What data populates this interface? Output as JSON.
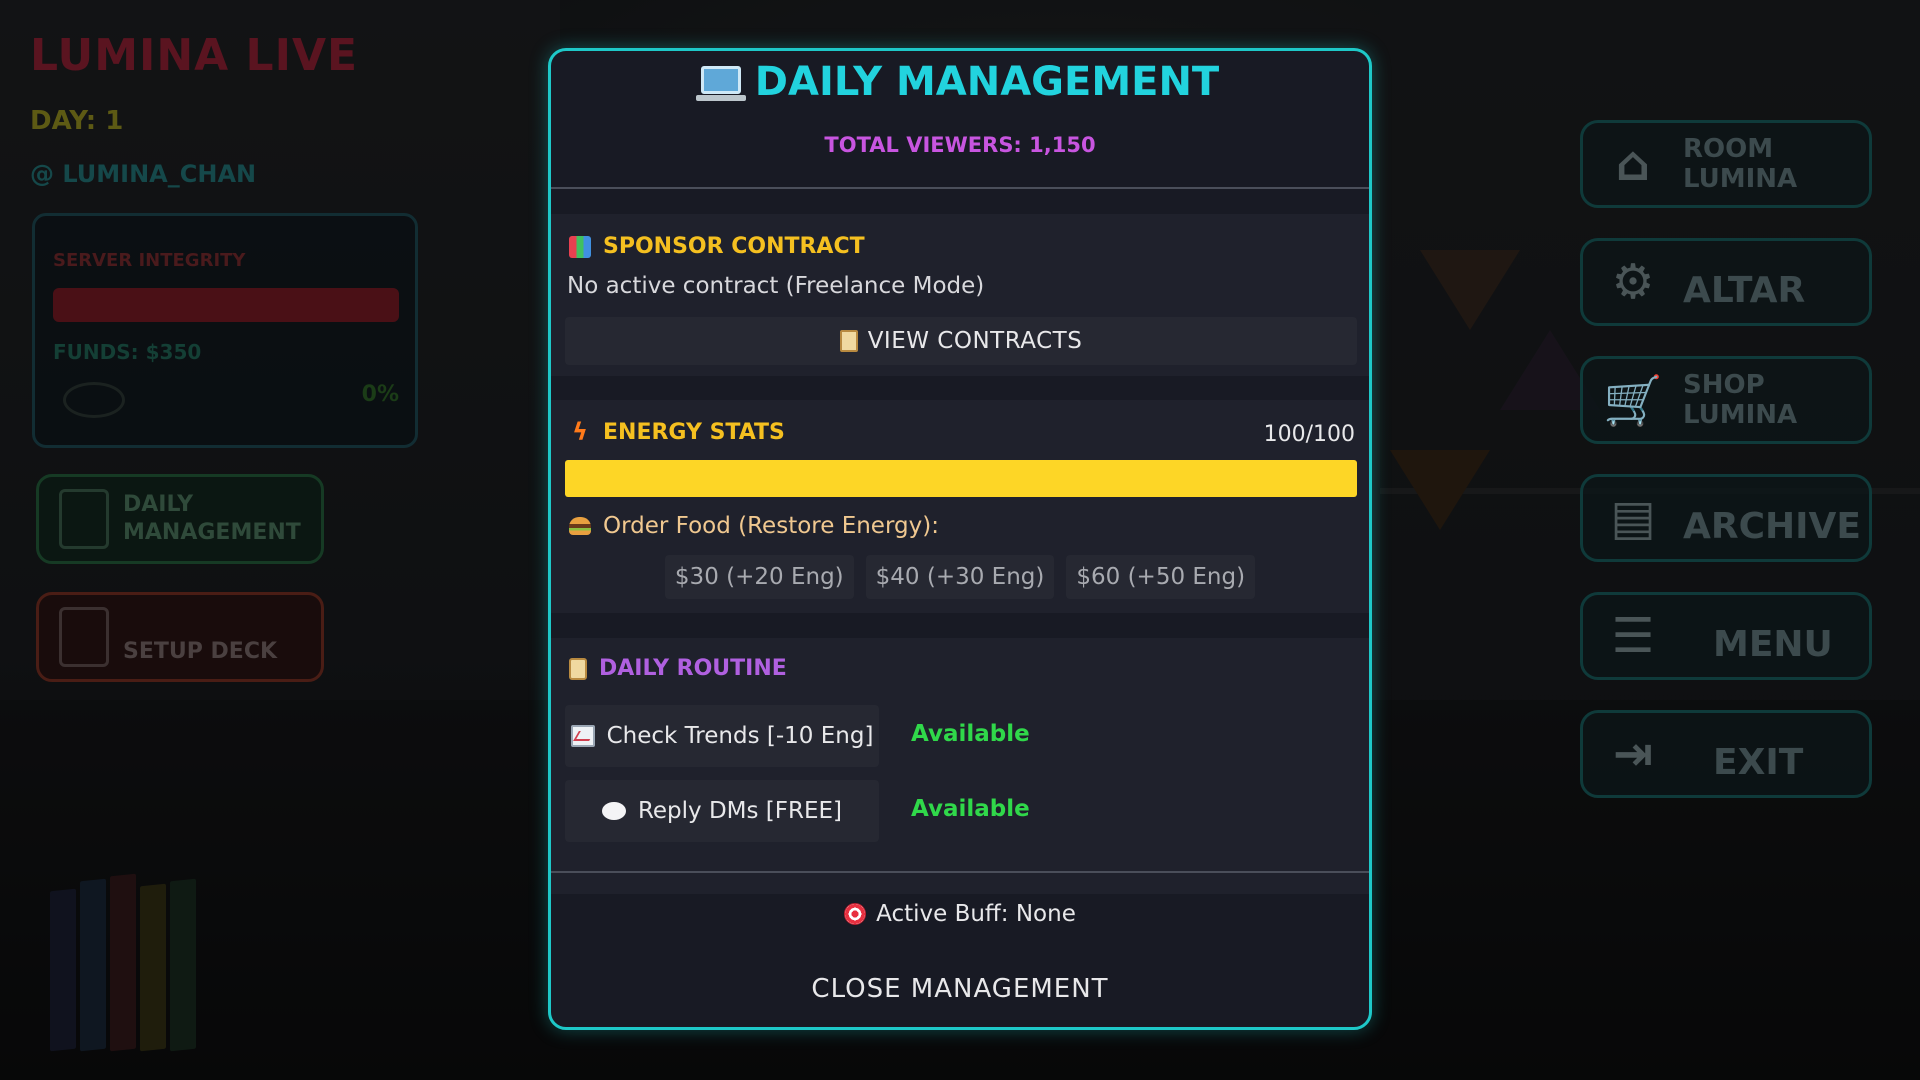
{
  "hud": {
    "title": "LUMINA LIVE",
    "day": "DAY: 1",
    "handle": "@ LUMINA_CHAN",
    "server_label": "SERVER INTEGRITY",
    "funds": "FUNDS: $350",
    "percent": "0%",
    "daily_btn": "DAILY MANAGEMENT",
    "deck_btn": "SETUP DECK"
  },
  "right_menu": [
    {
      "label": "ROOM LUMINA",
      "icon": "house-icon"
    },
    {
      "label": "ALTAR",
      "icon": "gear-icon"
    },
    {
      "label": "SHOP LUMINA",
      "icon": "cart-icon"
    },
    {
      "label": "ARCHIVE",
      "icon": "book-icon"
    },
    {
      "label": "MENU",
      "icon": "menu-icon"
    },
    {
      "label": "EXIT",
      "icon": "exit-icon"
    }
  ],
  "modal": {
    "title": "DAILY MANAGEMENT",
    "title_icon": "laptop-icon",
    "viewers": "TOTAL VIEWERS: 1,150",
    "sponsor": {
      "heading": "SPONSOR CONTRACT",
      "icon": "bar-chart-icon",
      "status": "No active contract (Freelance Mode)",
      "view_button": "VIEW CONTRACTS",
      "view_icon": "clipboard-icon"
    },
    "energy": {
      "heading": "ENERGY STATS",
      "icon": "lightning-icon",
      "value_text": "100/100",
      "current": 100,
      "max": 100,
      "bar_color": "#fdd626",
      "food_label": "Order Food (Restore Energy):",
      "food_icon": "burger-icon",
      "food_options": [
        "$30 (+20 Eng)",
        "$40 (+30 Eng)",
        "$60 (+50 Eng)"
      ]
    },
    "routine": {
      "heading": "DAILY ROUTINE",
      "icon": "clipboard-icon",
      "items": [
        {
          "label": "Check Trends [-10 Eng]",
          "icon": "chart-increasing-icon",
          "status": "Available"
        },
        {
          "label": "Reply DMs [FREE]",
          "icon": "speech-bubble-icon",
          "status": "Available"
        }
      ],
      "available_color": "#30d84a"
    },
    "buff": "Active Buff: None",
    "buff_icon": "target-icon",
    "close_button": "CLOSE MANAGEMENT"
  },
  "colors": {
    "accent": "#1ec8c8",
    "title": "#22d3de",
    "viewers": "#c855e0",
    "section_yellow": "#f5c020",
    "routine_purple": "#b060e0"
  }
}
